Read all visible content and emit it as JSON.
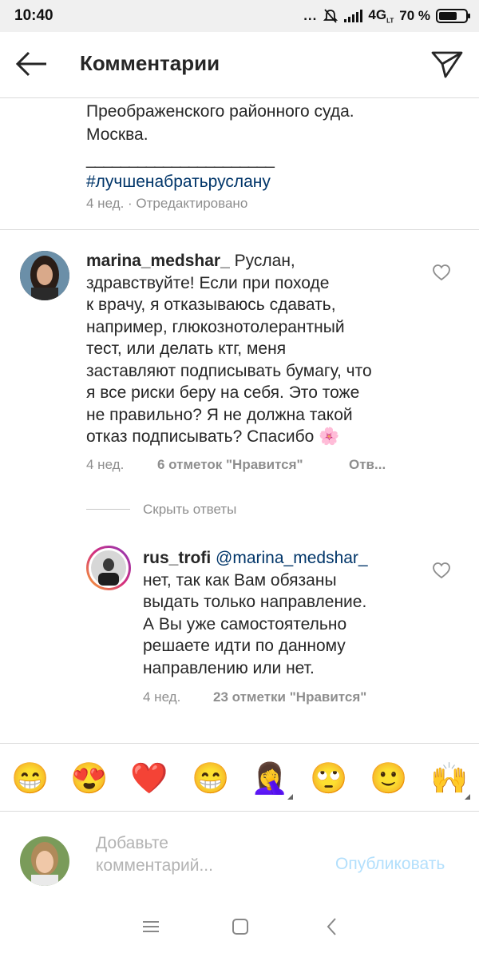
{
  "status_bar": {
    "time": "10:40",
    "dots": "...",
    "network": "4G",
    "network_sub": "LT",
    "battery": "70 %"
  },
  "header": {
    "title": "Комментарии"
  },
  "previous_comment": {
    "line1": "Преображенского районного суда.",
    "line2": "Москва.",
    "divider": "______________________",
    "hashtag": "#лучшенабратьруслану",
    "meta": "4 нед. · Отредактировано"
  },
  "comment1": {
    "username": "marina_medshar_",
    "lines": [
      "Руслан,",
      "здравствуйте! Если при походе",
      "к врачу, я отказываюсь сдавать,",
      "например, глюкознотолерантный",
      "тест, или делать ктг, меня",
      "заставляют подписывать бумагу, что",
      "я все риски беру на себя. Это тоже",
      "не правильно? Я не должна такой",
      "отказ подписывать? Спасибо"
    ],
    "flower": "🌸",
    "time": "4 нед.",
    "likes": "6 отметок \"Нравится\"",
    "reply": "Отв..."
  },
  "hide_replies": "Скрыть ответы",
  "reply1": {
    "username": "rus_trofi",
    "mention": "@marina_medshar_",
    "lines": [
      "нет, так как Вам обязаны",
      "выдать только направление.",
      "А Вы уже самостоятельно",
      "решаете идти по данному",
      "направлению или нет."
    ],
    "time": "4 нед.",
    "likes": "23 отметки \"Нравится\""
  },
  "emoji_bar": [
    "😁",
    "😍",
    "❤️",
    "😁",
    "🤦‍♀️",
    "🙄",
    "🙂",
    "🙌"
  ],
  "composer": {
    "placeholder_line1": "Добавьте",
    "placeholder_line2": "комментарий...",
    "publish": "Опубликовать"
  },
  "colors": {
    "text": "#262626",
    "secondary": "#8e8e8e",
    "link": "#003569",
    "publish": "#b2dffc",
    "divider": "#dbdbdb"
  }
}
